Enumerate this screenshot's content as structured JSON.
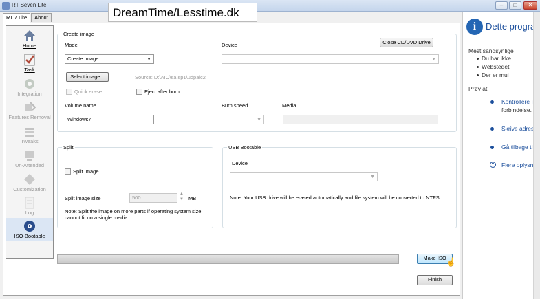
{
  "window": {
    "title": "RT Seven Lite",
    "minimize": "–",
    "maximize": "□",
    "close": "✕"
  },
  "overlay_title": "DreamTime/Lesstime.dk",
  "tabs": [
    {
      "label": "RT 7 Lite"
    },
    {
      "label": "About"
    }
  ],
  "nav": [
    {
      "label": "Home",
      "icon": "home-icon",
      "color": "#6b7fa0"
    },
    {
      "label": "Task",
      "icon": "task-icon",
      "color": "#b04a3a"
    },
    {
      "label": "Integration",
      "icon": "integration-icon",
      "color": "#7a8a7a"
    },
    {
      "label": "Features Removal",
      "icon": "features-removal-icon",
      "color": "#8a8a8a"
    },
    {
      "label": "Tweaks",
      "icon": "tweaks-icon",
      "color": "#8a8a8a"
    },
    {
      "label": "Un-Attended",
      "icon": "unattended-icon",
      "color": "#8a8a8a"
    },
    {
      "label": "Customization",
      "icon": "customization-icon",
      "color": "#8a8a8a"
    },
    {
      "label": "Log",
      "icon": "log-icon",
      "color": "#8a8a8a"
    },
    {
      "label": "ISO-Bootable",
      "icon": "iso-bootable-icon",
      "color": "#2a4d8c"
    }
  ],
  "create_image": {
    "group_title": "Create image",
    "mode_label": "Mode",
    "mode_value": "Create Image",
    "device_label": "Device",
    "close_drive_button": "Close CD/DVD Drive",
    "select_image_button": "Select image...",
    "source_text": "Source: D:\\AIO\\sa sp1\\udpaic2",
    "quick_erase_label": "Quick erase",
    "eject_after_burn_label": "Eject after burn",
    "volume_name_label": "Volume name",
    "volume_name_value": "Windows7",
    "burn_speed_label": "Burn speed",
    "media_label": "Media"
  },
  "split": {
    "group_title": "Split",
    "split_image_label": "Split Image",
    "split_size_label": "Split image size",
    "split_size_value": "500",
    "unit": "MB",
    "note_line1": "Note: Split the image on more parts if operating system size",
    "note_line2": "cannot fit on a single media."
  },
  "usb": {
    "group_title": "USB Bootable",
    "device_label": "Device",
    "note": "Note: Your USB drive will be erased automatically and file system will be converted to NTFS."
  },
  "progress": {
    "value": 0
  },
  "buttons": {
    "make_iso": "Make ISO",
    "finish": "Finish"
  },
  "right_pane": {
    "title": "Dette program",
    "intro": "Mest sandsynlige",
    "bullets": [
      "Du har ikke",
      "Webstedet",
      "Der er mul"
    ],
    "try_label": "Prøv at:",
    "items": [
      "Kontrollere in",
      "forbindelse.",
      "Skrive adress",
      "Gå tilbage til",
      "Flere oplysni"
    ]
  }
}
